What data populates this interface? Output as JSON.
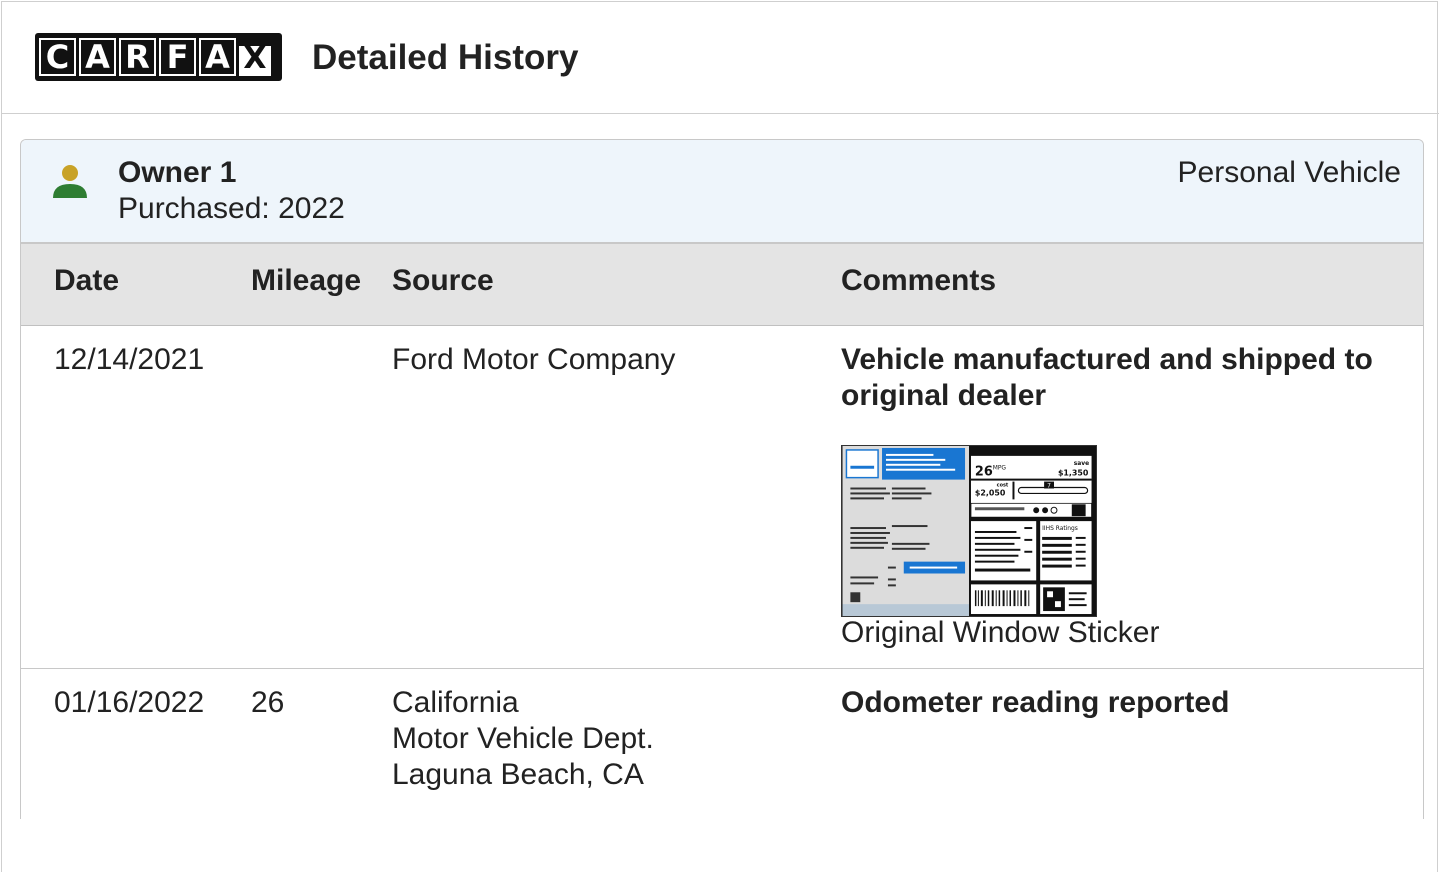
{
  "header": {
    "logo_letters": [
      "C",
      "A",
      "R",
      "F",
      "A",
      "X"
    ],
    "title": "Detailed History"
  },
  "owner": {
    "name": "Owner 1",
    "purchased": "Purchased: 2022",
    "vehicle_type": "Personal Vehicle",
    "icon": "person-icon",
    "icon_colors": {
      "head": "#c8a227",
      "body": "#2e7d32"
    }
  },
  "table": {
    "headers": {
      "date": "Date",
      "mileage": "Mileage",
      "source": "Source",
      "comments": "Comments"
    },
    "rows": [
      {
        "date": "12/14/2021",
        "mileage": "",
        "source": [
          "Ford Motor Company"
        ],
        "comment": "Vehicle manufactured and shipped to original dealer",
        "attachment": "Original Window Sticker",
        "sticker": {
          "mpg": "26",
          "mpg_unit": "MPG",
          "save_label": "save",
          "save": "$1,350",
          "cost_label": "cost",
          "cost": "$2,050",
          "rating": "7",
          "ratings_title": "IIHS Ratings"
        }
      },
      {
        "date": "01/16/2022",
        "mileage": "26",
        "source": [
          "California",
          "Motor Vehicle Dept.",
          "Laguna Beach, CA"
        ],
        "comment": "Odometer reading reported",
        "attachment": ""
      }
    ]
  },
  "colors": {
    "sticker_blue": "#1976d2",
    "owner_bg": "#eef5fb",
    "header_bg": "#e4e4e4"
  }
}
